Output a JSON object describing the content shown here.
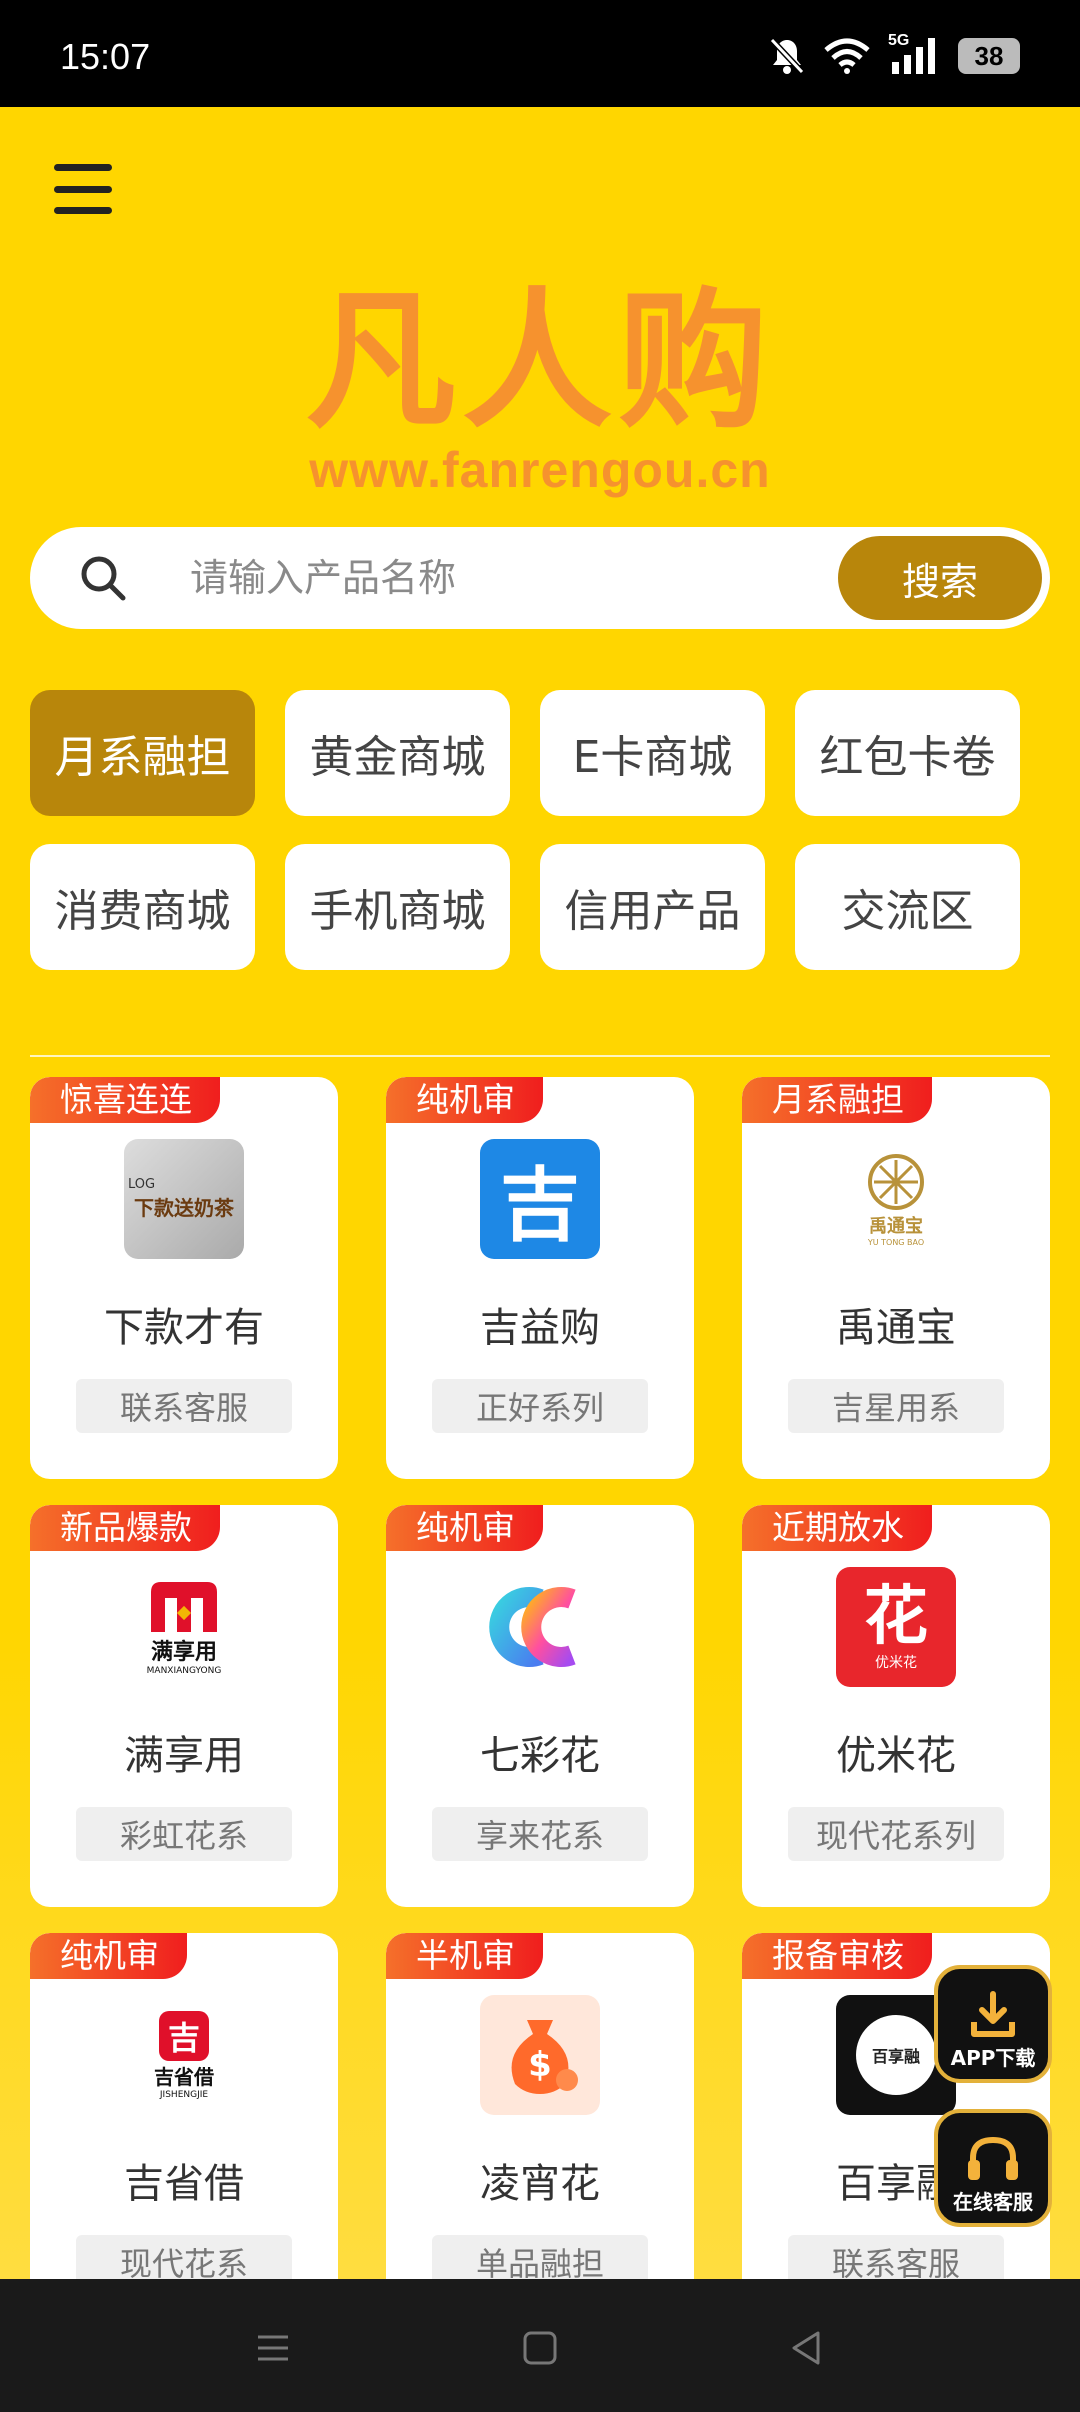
{
  "status_bar": {
    "time": "15:07",
    "network": "5G",
    "battery": "38"
  },
  "header": {
    "brand": "凡人购",
    "url": "www.fanrengou.cn"
  },
  "search": {
    "placeholder": "请输入产品名称",
    "button": "搜索"
  },
  "categories": [
    {
      "label": "月系融担",
      "active": true
    },
    {
      "label": "黄金商城"
    },
    {
      "label": "E卡商城"
    },
    {
      "label": "红包卡卷"
    },
    {
      "label": "消费商城"
    },
    {
      "label": "手机商城"
    },
    {
      "label": "信用产品"
    },
    {
      "label": "交流区"
    }
  ],
  "products": [
    {
      "tag": "惊喜连连",
      "name": "下款才有",
      "series": "联系客服",
      "logo_text": "下款送奶茶",
      "logo_sub": "LOG"
    },
    {
      "tag": "纯机审",
      "name": "吉益购",
      "series": "正好系列",
      "logo_text": "吉"
    },
    {
      "tag": "月系融担",
      "name": "禹通宝",
      "series": "吉星用系",
      "logo_text": "禹通宝",
      "logo_sub": "YU TONG BAO"
    },
    {
      "tag": "新品爆款",
      "name": "满享用",
      "series": "彩虹花系",
      "logo_text": "满享用",
      "logo_sub": "MANXIANGYONG"
    },
    {
      "tag": "纯机审",
      "name": "七彩花",
      "series": "享来花系"
    },
    {
      "tag": "近期放水",
      "name": "优米花",
      "series": "现代花系列",
      "logo_text": "花",
      "logo_sub": "优米花"
    },
    {
      "tag": "纯机审",
      "name": "吉省借",
      "series": "现代花系",
      "logo_text": "吉省借",
      "logo_sub": "JISHENGJIE"
    },
    {
      "tag": "半机审",
      "name": "凌宵花",
      "series": "单品融担"
    },
    {
      "tag": "报备审核",
      "name": "百享融",
      "series": "联系客服",
      "logo_text": "百享融"
    }
  ],
  "floating": {
    "download": "APP下载",
    "service": "在线客服"
  },
  "colors": {
    "background": "#FFD600",
    "accent": "#B8860B",
    "brand": "#F6922E",
    "tag": "#F01E1E"
  }
}
